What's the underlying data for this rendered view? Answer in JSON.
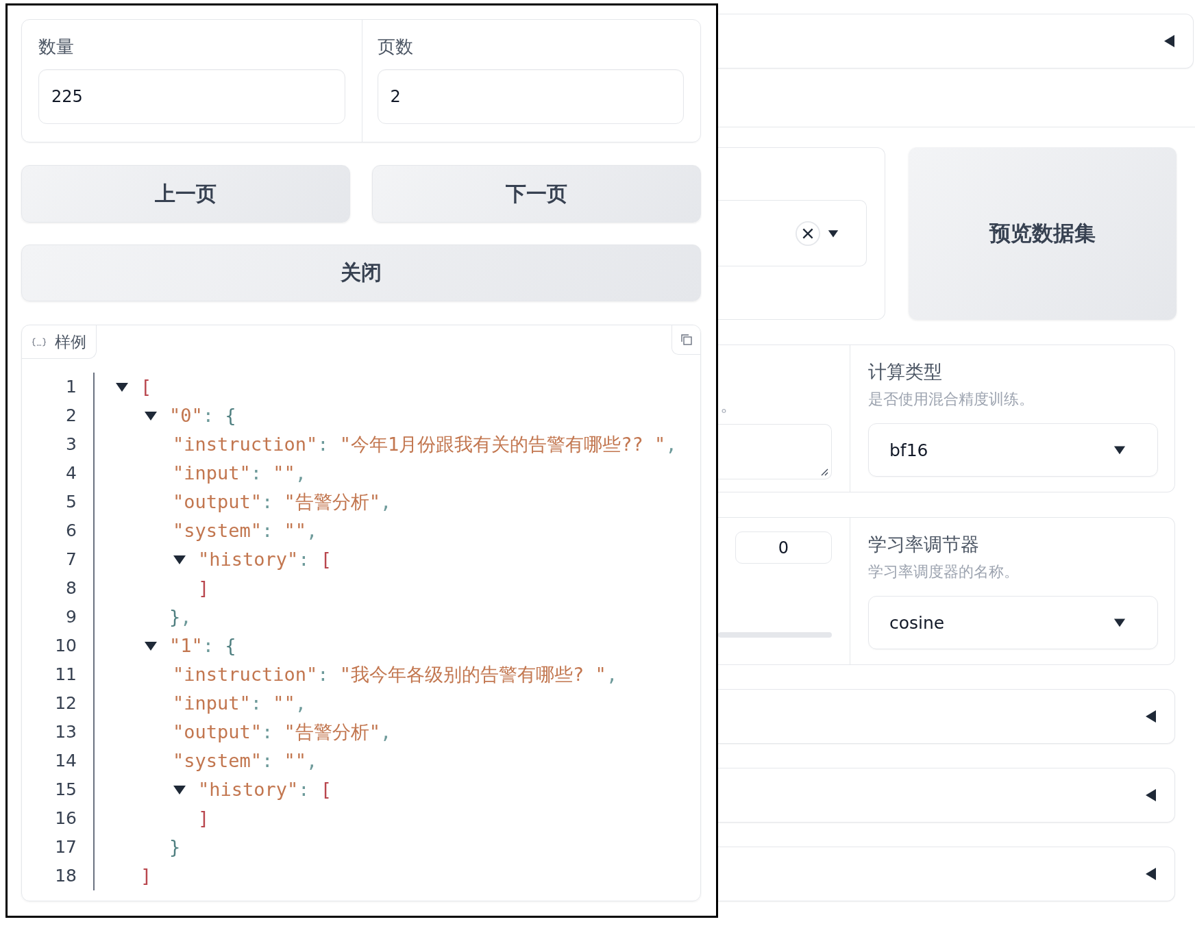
{
  "background": {
    "top_accordion": {
      "expanded": false
    },
    "preview_button": "预览数据集",
    "partial_info": "。",
    "number_field": "0",
    "settings": [
      {
        "label": "计算类型",
        "info": "是否使用混合精度训练。",
        "value": "bf16"
      },
      {
        "label": "学习率调节器",
        "info": "学习率调度器的名称。",
        "value": "cosine"
      }
    ],
    "accordions": [
      {
        "expanded": false
      },
      {
        "expanded": false
      },
      {
        "expanded": false
      }
    ]
  },
  "modal": {
    "fields": [
      {
        "label": "数量",
        "value": "225"
      },
      {
        "label": "页数",
        "value": "2"
      }
    ],
    "page_buttons": [
      "上一页",
      "下一页"
    ],
    "close_button": "关闭",
    "code_viewer": {
      "label": "样例",
      "tree": {
        "number": "1",
        "tokens": [
          {
            "kind": "bracket",
            "text": "["
          }
        ],
        "expanded": true,
        "children": [
          {
            "number": "2",
            "tokens": [
              {
                "kind": "string",
                "text": "\"0\""
              },
              {
                "kind": "punct",
                "text": ": "
              },
              {
                "kind": "brace",
                "text": "{"
              }
            ],
            "expanded": true,
            "children": [
              {
                "number": "3",
                "tokens": [
                  {
                    "kind": "string",
                    "text": "\"instruction\""
                  },
                  {
                    "kind": "punct",
                    "text": ": "
                  },
                  {
                    "kind": "string",
                    "text": "\"今年1月份跟我有关的告警有哪些?? \""
                  },
                  {
                    "kind": "punct",
                    "text": ","
                  }
                ]
              },
              {
                "number": "4",
                "tokens": [
                  {
                    "kind": "string",
                    "text": "\"input\""
                  },
                  {
                    "kind": "punct",
                    "text": ": "
                  },
                  {
                    "kind": "string",
                    "text": "\"\""
                  },
                  {
                    "kind": "punct",
                    "text": ","
                  }
                ]
              },
              {
                "number": "5",
                "tokens": [
                  {
                    "kind": "string",
                    "text": "\"output\""
                  },
                  {
                    "kind": "punct",
                    "text": ": "
                  },
                  {
                    "kind": "string",
                    "text": "\"告警分析\""
                  },
                  {
                    "kind": "punct",
                    "text": ","
                  }
                ]
              },
              {
                "number": "6",
                "tokens": [
                  {
                    "kind": "string",
                    "text": "\"system\""
                  },
                  {
                    "kind": "punct",
                    "text": ": "
                  },
                  {
                    "kind": "string",
                    "text": "\"\""
                  },
                  {
                    "kind": "punct",
                    "text": ","
                  }
                ]
              },
              {
                "number": "7",
                "tokens": [
                  {
                    "kind": "string",
                    "text": "\"history\""
                  },
                  {
                    "kind": "punct",
                    "text": ": "
                  },
                  {
                    "kind": "bracket",
                    "text": "["
                  }
                ],
                "expanded": true,
                "close": {
                  "number": "8",
                  "tokens": [
                    {
                      "kind": "bracket",
                      "text": "]"
                    }
                  ]
                }
              }
            ],
            "close": {
              "number": "9",
              "tokens": [
                {
                  "kind": "brace",
                  "text": "}"
                },
                {
                  "kind": "punct",
                  "text": ","
                }
              ]
            }
          },
          {
            "number": "10",
            "tokens": [
              {
                "kind": "string",
                "text": "\"1\""
              },
              {
                "kind": "punct",
                "text": ": "
              },
              {
                "kind": "brace",
                "text": "{"
              }
            ],
            "expanded": true,
            "children": [
              {
                "number": "11",
                "tokens": [
                  {
                    "kind": "string",
                    "text": "\"instruction\""
                  },
                  {
                    "kind": "punct",
                    "text": ": "
                  },
                  {
                    "kind": "string",
                    "text": "\"我今年各级别的告警有哪些? \""
                  },
                  {
                    "kind": "punct",
                    "text": ","
                  }
                ]
              },
              {
                "number": "12",
                "tokens": [
                  {
                    "kind": "string",
                    "text": "\"input\""
                  },
                  {
                    "kind": "punct",
                    "text": ": "
                  },
                  {
                    "kind": "string",
                    "text": "\"\""
                  },
                  {
                    "kind": "punct",
                    "text": ","
                  }
                ]
              },
              {
                "number": "13",
                "tokens": [
                  {
                    "kind": "string",
                    "text": "\"output\""
                  },
                  {
                    "kind": "punct",
                    "text": ": "
                  },
                  {
                    "kind": "string",
                    "text": "\"告警分析\""
                  },
                  {
                    "kind": "punct",
                    "text": ","
                  }
                ]
              },
              {
                "number": "14",
                "tokens": [
                  {
                    "kind": "string",
                    "text": "\"system\""
                  },
                  {
                    "kind": "punct",
                    "text": ": "
                  },
                  {
                    "kind": "string",
                    "text": "\"\""
                  },
                  {
                    "kind": "punct",
                    "text": ","
                  }
                ]
              },
              {
                "number": "15",
                "tokens": [
                  {
                    "kind": "string",
                    "text": "\"history\""
                  },
                  {
                    "kind": "punct",
                    "text": ": "
                  },
                  {
                    "kind": "bracket",
                    "text": "["
                  }
                ],
                "expanded": true,
                "close": {
                  "number": "16",
                  "tokens": [
                    {
                      "kind": "bracket",
                      "text": "]"
                    }
                  ]
                }
              }
            ],
            "close": {
              "number": "17",
              "tokens": [
                {
                  "kind": "brace",
                  "text": "}"
                }
              ]
            }
          }
        ],
        "close": {
          "number": "18",
          "tokens": [
            {
              "kind": "bracket",
              "text": "]"
            }
          ]
        }
      }
    }
  }
}
